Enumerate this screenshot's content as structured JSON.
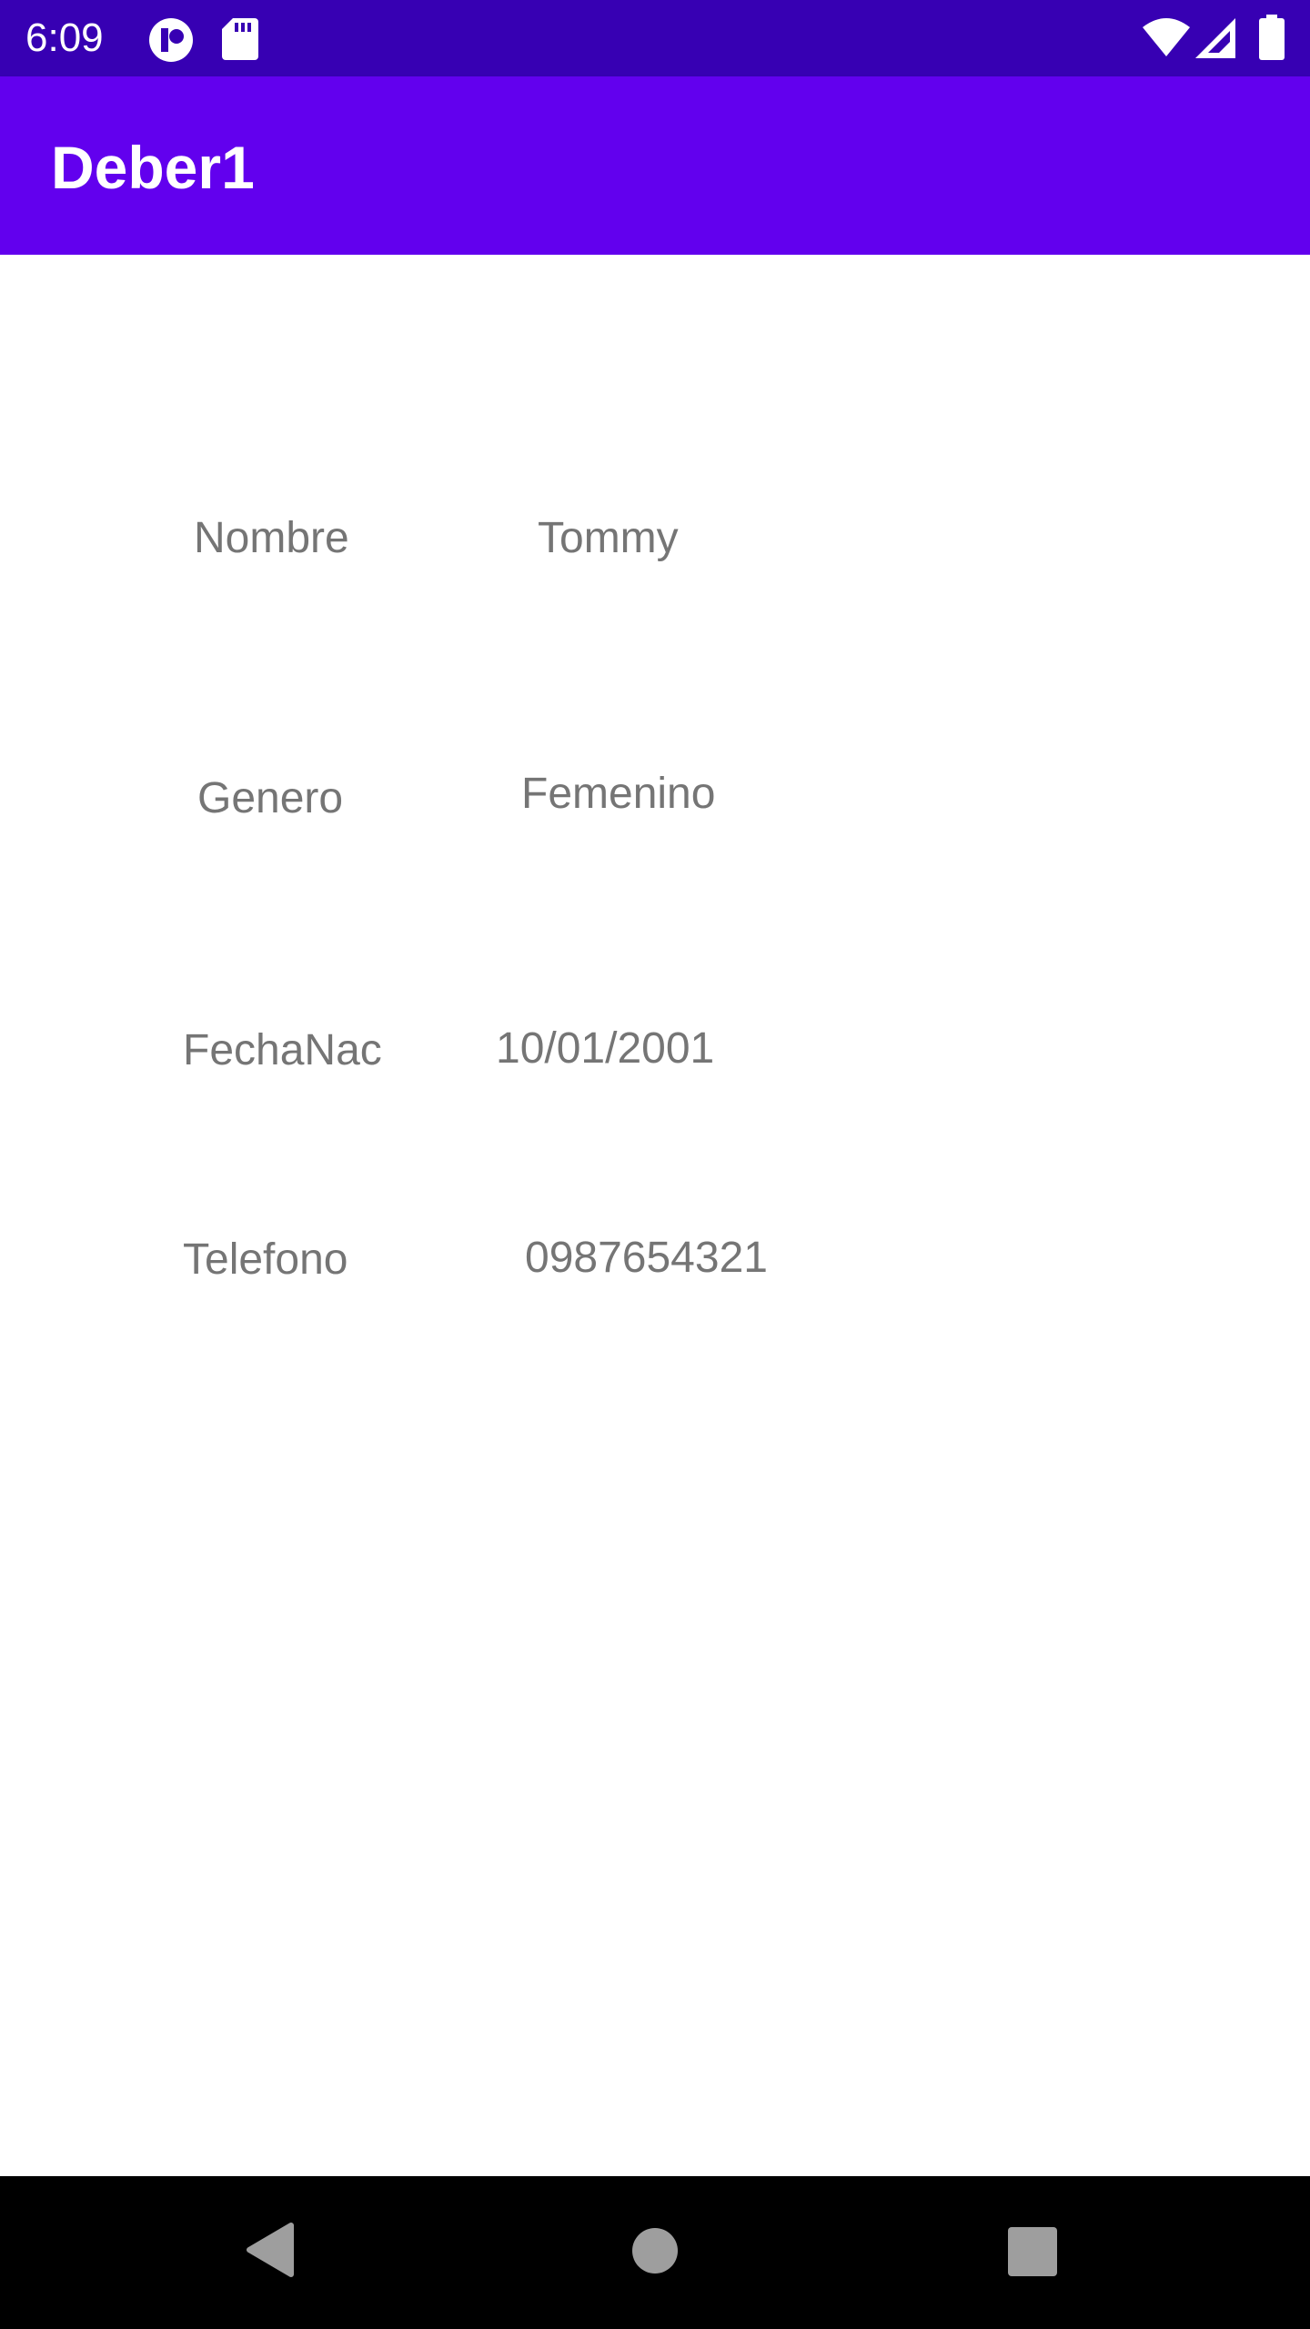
{
  "status_bar": {
    "time": "6:09",
    "icons": [
      "notification-app-icon",
      "sd-card-icon",
      "wifi-icon",
      "cell-signal-icon",
      "battery-icon"
    ],
    "background": "#3700b3"
  },
  "app_bar": {
    "title": "Deber1",
    "background": "#6200ee"
  },
  "form": {
    "nombre": {
      "label": "Nombre",
      "value": "Tommy"
    },
    "genero": {
      "label": "Genero",
      "value": "Femenino"
    },
    "fecha_nac": {
      "label": "FechaNac",
      "value": "10/01/2001"
    },
    "telefono": {
      "label": "Telefono",
      "value": "0987654321"
    }
  },
  "nav_bar": {
    "buttons": [
      "back-icon",
      "home-icon",
      "recents-icon"
    ],
    "background": "#000000"
  }
}
